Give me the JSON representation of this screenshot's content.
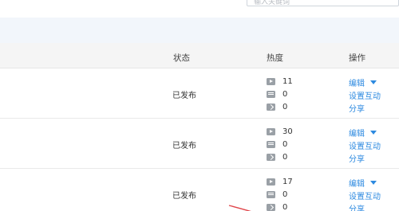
{
  "search": {
    "placeholder": "输入关键词"
  },
  "table": {
    "headers": {
      "status": "状态",
      "heat": "热度",
      "ops": "操作"
    },
    "rows": [
      {
        "status": "已发布",
        "plays": "11",
        "comments": "0",
        "shares": "0"
      },
      {
        "status": "已发布",
        "plays": "30",
        "comments": "0",
        "shares": "0"
      },
      {
        "status": "已发布",
        "plays": "17",
        "comments": "0",
        "shares": "0"
      }
    ],
    "actions": {
      "edit": "编辑",
      "interact": "设置互动",
      "share": "分享"
    }
  },
  "icons": {
    "plays": "play-icon",
    "comments": "comment-icon",
    "shares": "share-icon",
    "edit_menu": "caret-down-icon"
  },
  "colors": {
    "link": "#2d8ae0",
    "icon": "#9aa0a6",
    "band": "#f2f6fb",
    "header_bg": "#f5f5f5",
    "annotation": "#e0454a"
  }
}
